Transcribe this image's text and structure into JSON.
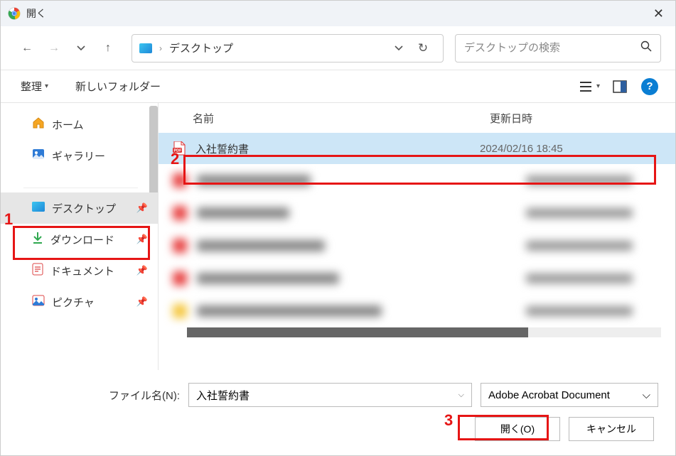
{
  "window": {
    "title": "開く"
  },
  "nav": {
    "breadcrumb_location": "デスクトップ",
    "search_placeholder": "デスクトップの検索"
  },
  "toolbar": {
    "organize": "整理",
    "new_folder": "新しいフォルダー"
  },
  "sidebar": {
    "home": "ホーム",
    "gallery": "ギャラリー",
    "desktop": "デスクトップ",
    "downloads": "ダウンロード",
    "documents": "ドキュメント",
    "pictures": "ピクチャ"
  },
  "file_headers": {
    "name": "名前",
    "date": "更新日時"
  },
  "files": {
    "selected": {
      "name": "入社誓約書",
      "date": "2024/02/16 18:45"
    }
  },
  "bottom": {
    "filename_label": "ファイル名(N):",
    "filename_value": "入社誓約書",
    "filetype": "Adobe Acrobat Document",
    "open": "開く(O)",
    "cancel": "キャンセル"
  },
  "annotations": {
    "n1": "1",
    "n2": "2",
    "n3": "3"
  }
}
